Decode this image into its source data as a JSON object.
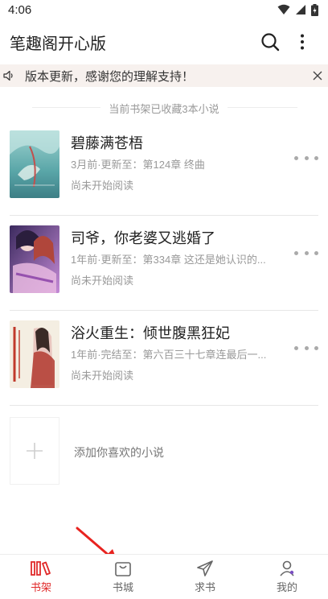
{
  "status_bar": {
    "time": "4:06"
  },
  "app_bar": {
    "title": "笔趣阁开心版"
  },
  "notice": {
    "text": "版本更新，感谢您的理解支持！"
  },
  "shelf": {
    "summary": "当前书架已收藏3本小说",
    "books": [
      {
        "title": "碧藤满苍梧",
        "meta": "3月前·更新至：第124章 终曲",
        "read_status": "尚未开始阅读"
      },
      {
        "title": "司爷，你老婆又逃婚了",
        "meta": "1年前·更新至：第334章 这还是她认识的...",
        "read_status": "尚未开始阅读"
      },
      {
        "title": "浴火重生：倾世腹黑狂妃",
        "meta": "1年前·完结至：第六百三十七章连最后一...",
        "read_status": "尚未开始阅读"
      }
    ],
    "add_label": "添加你喜欢的小说"
  },
  "tabs": [
    {
      "label": "书架",
      "icon": "bookshelf-icon",
      "active": true
    },
    {
      "label": "书城",
      "icon": "bag-icon",
      "active": false
    },
    {
      "label": "求书",
      "icon": "send-icon",
      "active": false
    },
    {
      "label": "我的",
      "icon": "user-icon",
      "active": false
    }
  ],
  "colors": {
    "accent": "#e02b2b",
    "annotation_arrow": "#e8231f"
  }
}
